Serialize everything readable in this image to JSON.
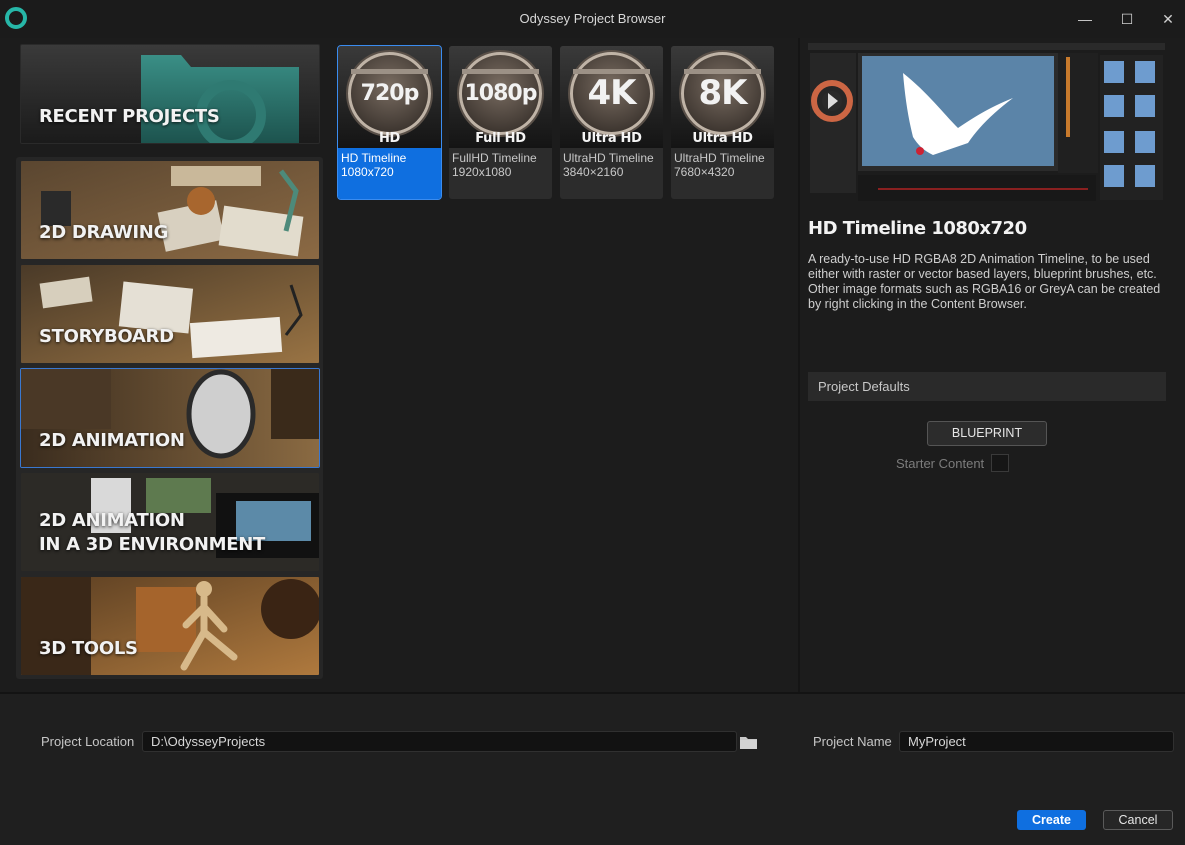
{
  "window": {
    "title": "Odyssey Project Browser",
    "minimize_icon": "—",
    "maximize_icon": "☐",
    "close_icon": "✕"
  },
  "categories": [
    {
      "label": "RECENT PROJECTS",
      "label2": "",
      "image": "teal-folder-icon"
    },
    {
      "label": "2D DRAWING",
      "label2": "",
      "image": "drawing-desk-photo"
    },
    {
      "label": "STORYBOARD",
      "label2": "",
      "image": "storyboard-desk-photo"
    },
    {
      "label": "2D ANIMATION",
      "label2": "",
      "image": "animation-desk-photo",
      "selected": true
    },
    {
      "label": "2D ANIMATION",
      "label2": "IN A 3D ENVIRONMENT",
      "image": "3d-environment-photo"
    },
    {
      "label": "3D TOOLS",
      "label2": "",
      "image": "mannequin-photo"
    }
  ],
  "templates": [
    {
      "badge": "720p",
      "subtitle": "HD",
      "name": "HD Timeline",
      "resolution": "1080x720",
      "selected": true
    },
    {
      "badge": "1080p",
      "subtitle": "Full HD",
      "name": "FullHD Timeline",
      "resolution": "1920x1080"
    },
    {
      "badge": "4K",
      "subtitle": "Ultra HD",
      "name": "UltraHD Timeline",
      "resolution": "3840×2160"
    },
    {
      "badge": "8K",
      "subtitle": "Ultra HD",
      "name": "UltraHD Timeline",
      "resolution": "7680×4320"
    }
  ],
  "detail": {
    "title": "HD Timeline 1080x720",
    "description": "A ready-to-use HD RGBA8 2D Animation Timeline, to be used either with raster or vector based layers, blueprint brushes, etc. Other image formats such as RGBA16 or GreyA can be created by right clicking in the Content Browser."
  },
  "defaults": {
    "header": "Project Defaults",
    "blueprint_label": "BLUEPRINT",
    "starter_content_label": "Starter Content",
    "starter_content_checked": false
  },
  "bottom": {
    "location_label": "Project Location",
    "location_value": "D:\\OdysseyProjects",
    "name_label": "Project Name",
    "name_value": "MyProject",
    "create_label": "Create",
    "cancel_label": "Cancel"
  },
  "colors": {
    "accent": "#0f6fe0",
    "logo": "#27b7a8",
    "background": "#1c1c1c"
  }
}
